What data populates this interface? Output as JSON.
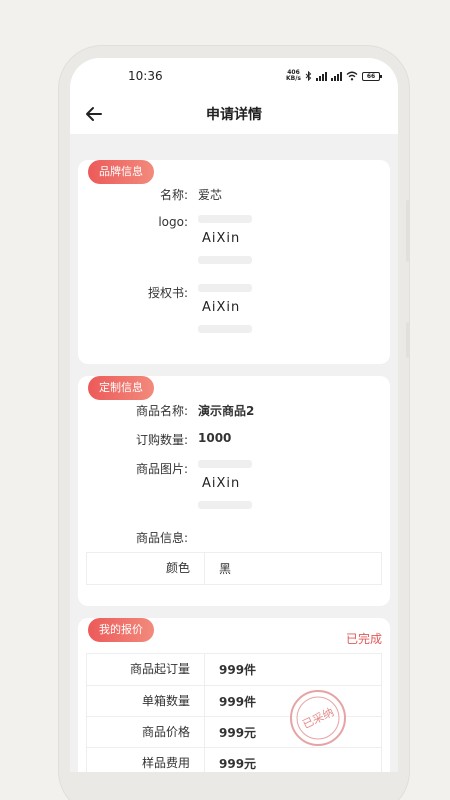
{
  "status_bar": {
    "time": "10:36",
    "net_speed_value": "406",
    "net_speed_unit": "KB/s",
    "battery": "66"
  },
  "nav": {
    "title": "申请详情"
  },
  "brand_section": {
    "tag": "品牌信息",
    "name_label": "名称:",
    "name_value": "爱芯",
    "logo_label": "logo:",
    "logo_text": "AiXin",
    "auth_label": "授权书:",
    "auth_text": "AiXin"
  },
  "custom_section": {
    "tag": "定制信息",
    "product_name_label": "商品名称:",
    "product_name_value": "演示商品2",
    "order_qty_label": "订购数量:",
    "order_qty_value": "1000",
    "image_label": "商品图片:",
    "image_text": "AiXin",
    "info_label": "商品信息:",
    "attrs": [
      {
        "key": "颜色",
        "value": "黑"
      }
    ]
  },
  "quote_section": {
    "tag": "我的报价",
    "status": "已完成",
    "stamp_text": "已采纳",
    "rows": [
      {
        "key": "商品起订量",
        "value": "999件"
      },
      {
        "key": "单箱数量",
        "value": "999件"
      },
      {
        "key": "商品价格",
        "value": "999元"
      },
      {
        "key": "样品费用",
        "value": "999元"
      }
    ]
  },
  "colors": {
    "accent": "#ec5a5a",
    "status": "#e05a5a"
  }
}
